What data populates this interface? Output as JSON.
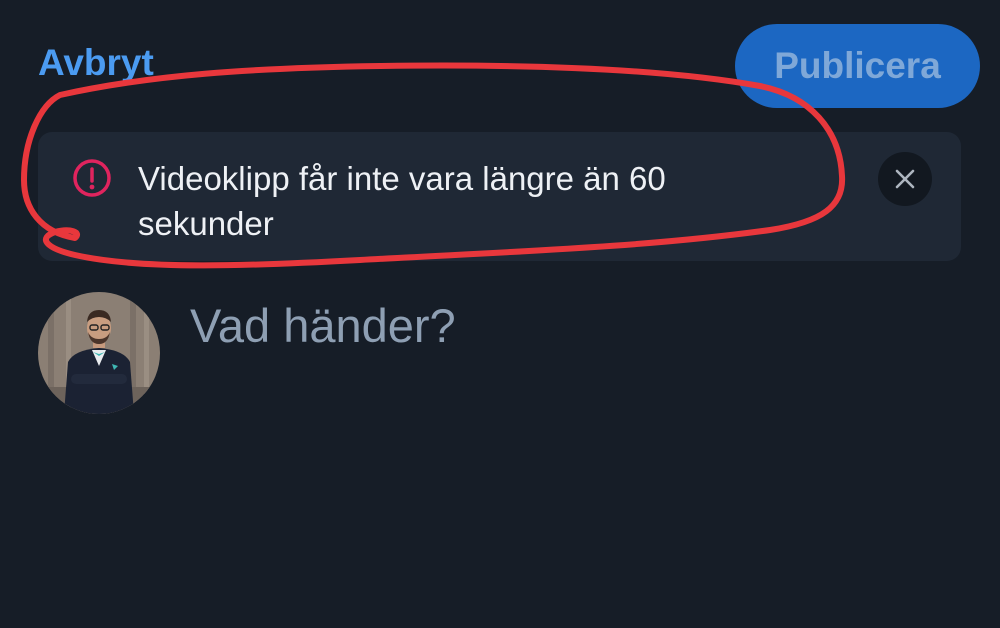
{
  "header": {
    "cancel_label": "Avbryt",
    "publish_label": "Publicera"
  },
  "banner": {
    "icon": "info-icon",
    "message": "Videoklipp får inte vara längre än 60 sekunder",
    "close_icon": "close-icon"
  },
  "composer": {
    "avatar": "avatar",
    "placeholder": "Vad händer?"
  },
  "colors": {
    "background": "#161d27",
    "accent": "#4b9bf1",
    "publish_button": "#1c67c2",
    "error_icon": "#e0245e",
    "annotation": "#e8373c"
  }
}
